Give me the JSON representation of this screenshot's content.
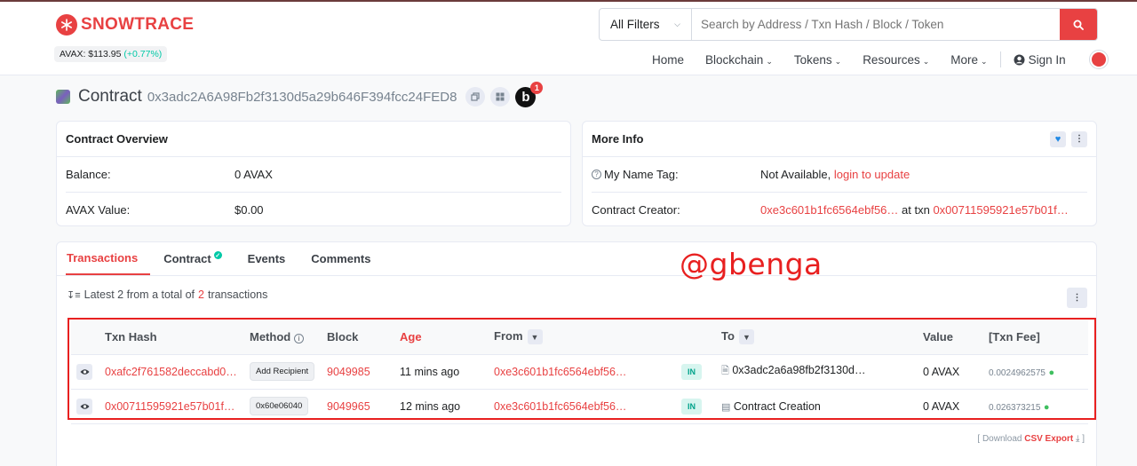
{
  "brand": {
    "name": "SNOWTRACE",
    "color": "#e84142"
  },
  "ticker": {
    "label": "AVAX: $113.95",
    "change": "(+0.77%)"
  },
  "search": {
    "filter_label": "All Filters",
    "placeholder": "Search by Address / Txn Hash / Block / Token"
  },
  "nav": {
    "home": "Home",
    "blockchain": "Blockchain",
    "tokens": "Tokens",
    "resources": "Resources",
    "more": "More",
    "signin": "Sign In"
  },
  "page": {
    "label": "Contract",
    "address": "0x3adc2A6A98Fb2f3130d5a29b646F394fcc24FED8",
    "badge_letter": "b",
    "badge_count": "1"
  },
  "overview": {
    "title": "Contract Overview",
    "balance_label": "Balance:",
    "balance_value": "0 AVAX",
    "value_label": "AVAX Value:",
    "value_value": "$0.00"
  },
  "more_info": {
    "title": "More Info",
    "nametag_label": "My Name Tag:",
    "nametag_value": "Not Available,",
    "nametag_link": "login to update",
    "creator_label": "Contract Creator:",
    "creator_addr": "0xe3c601b1fc6564ebf56…",
    "creator_at": "at txn",
    "creator_txn": "0x00711595921e57b01f…"
  },
  "tabs": [
    {
      "label": "Transactions"
    },
    {
      "label": "Contract"
    },
    {
      "label": "Events"
    },
    {
      "label": "Comments"
    }
  ],
  "watermark": "@gbenga",
  "summary": {
    "prefix": "Latest 2 from a total of",
    "count": "2",
    "suffix": "transactions"
  },
  "table": {
    "headers": {
      "hash": "Txn Hash",
      "method": "Method",
      "block": "Block",
      "age": "Age",
      "from": "From",
      "to": "To",
      "value": "Value",
      "fee": "[Txn Fee]"
    },
    "rows": [
      {
        "hash": "0xafc2f761582deccabd0…",
        "method": "Add Recipient",
        "block": "9049985",
        "age": "11 mins ago",
        "from": "0xe3c601b1fc6564ebf56…",
        "direction": "IN",
        "to": "0x3adc2a6a98fb2f3130d…",
        "to_icon": "document-icon",
        "value": "0 AVAX",
        "fee": "0.0024962575"
      },
      {
        "hash": "0x00711595921e57b01f…",
        "method": "0x60e06040",
        "block": "9049965",
        "age": "12 mins ago",
        "from": "0xe3c601b1fc6564ebf56…",
        "direction": "IN",
        "to": "Contract Creation",
        "to_icon": "contract-creation-icon",
        "value": "0 AVAX",
        "fee": "0.026373215"
      }
    ]
  },
  "export": {
    "prefix": "[ Download",
    "label": "CSV Export",
    "suffix": "]"
  }
}
